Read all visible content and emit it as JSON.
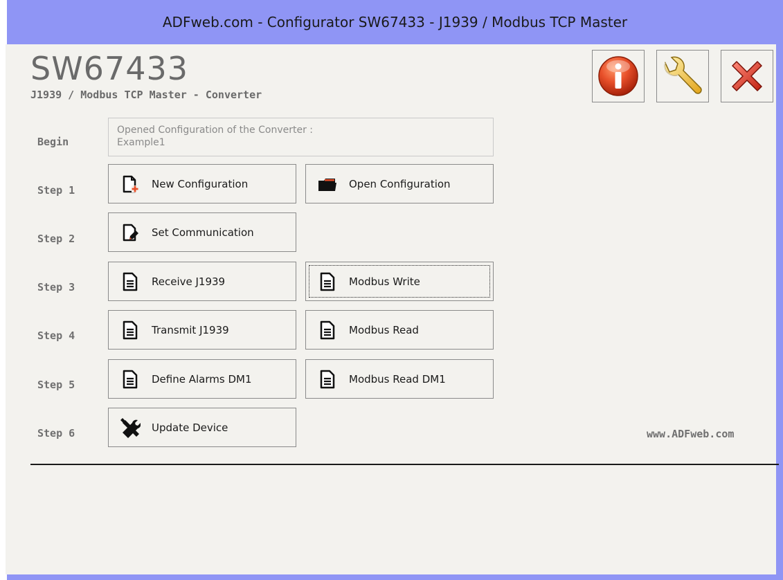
{
  "window": {
    "title": "ADFweb.com - Configurator SW67433 - J1939 / Modbus TCP Master"
  },
  "header": {
    "app_title": "SW67433",
    "app_subtitle": "J1939 / Modbus TCP Master - Converter"
  },
  "toolbar": {
    "info_icon": "info-icon",
    "settings_icon": "wrench-icon",
    "close_icon": "close-icon"
  },
  "begin": {
    "label": "Begin",
    "line1": "Opened Configuration of the Converter :",
    "line2": "Example1"
  },
  "steps": {
    "step1": {
      "label": "Step 1",
      "a": "New Configuration",
      "b": "Open Configuration"
    },
    "step2": {
      "label": "Step 2",
      "a": "Set Communication"
    },
    "step3": {
      "label": "Step 3",
      "a": "Receive J1939",
      "b": "Modbus Write"
    },
    "step4": {
      "label": "Step 4",
      "a": "Transmit J1939",
      "b": "Modbus Read"
    },
    "step5": {
      "label": "Step 5",
      "a": "Define Alarms DM1",
      "b": "Modbus Read DM1"
    },
    "step6": {
      "label": "Step 6",
      "a": "Update Device"
    }
  },
  "footer": {
    "website": "www.ADFweb.com"
  },
  "colors": {
    "titlebar": "#8f95f5",
    "background": "#f3f2ee",
    "accent": "#e8502a"
  }
}
